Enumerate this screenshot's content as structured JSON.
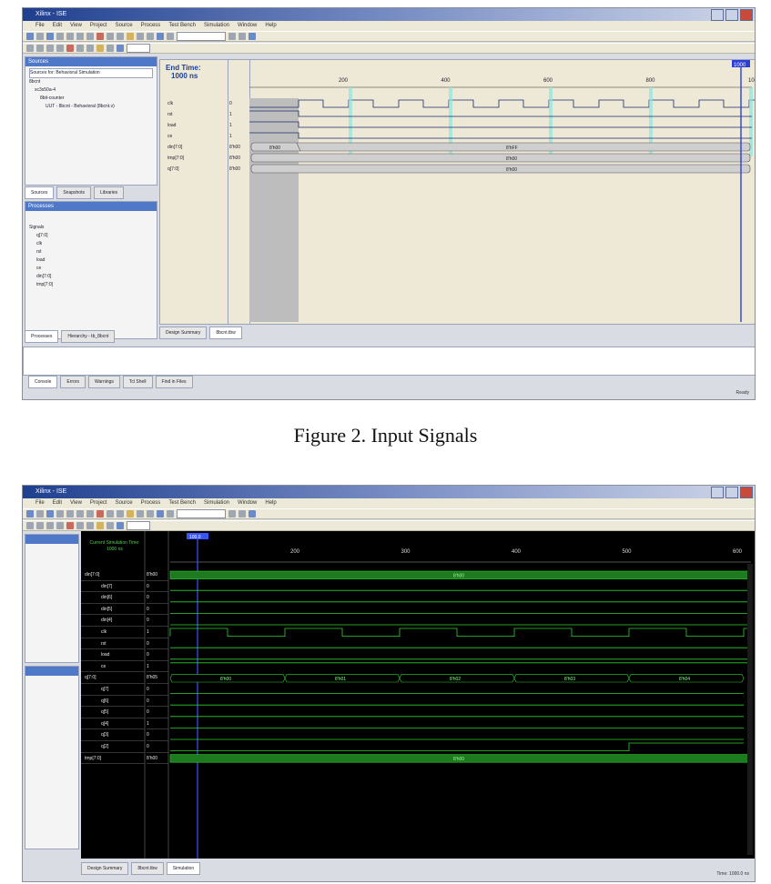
{
  "figure1": {
    "caption": "Figure 2.    Input Signals",
    "menu": [
      "File",
      "Edit",
      "View",
      "Project",
      "Source",
      "Process",
      "Test Bench",
      "Simulation",
      "Window",
      "Help"
    ],
    "sources_panel": {
      "title": "Sources",
      "subtitle": "Sources for: Behavioral Simulation",
      "tree": [
        "8bcnt",
        "xc3s50a-4",
        "8bit-counter",
        "UUT - 8bcnt - Behavioral (8bcnt.v)"
      ]
    },
    "left_tabs": [
      "Sources",
      "Snapshots",
      "Libraries"
    ],
    "process_panel": {
      "title": "Processes",
      "tree": [
        "Signals",
        "q[7:0]",
        "clk",
        "rst",
        "load",
        "ce",
        "din[7:0]",
        "tmp[7:0]"
      ]
    },
    "bottom_tabs": [
      "Processes",
      "Hierarchy - tb_8bcnt"
    ],
    "editor_tabs": [
      "Design Summary",
      "8bcnt.tbw"
    ],
    "end_time_label": "End Time:",
    "end_time_value": "1000 ns",
    "signals": [
      {
        "name": "clk",
        "value": "0"
      },
      {
        "name": "rst",
        "value": "1"
      },
      {
        "name": "load",
        "value": "1"
      },
      {
        "name": "ce",
        "value": "1"
      },
      {
        "name": "din[7:0]",
        "value": "8'h00"
      },
      {
        "name": "tmp[7:0]",
        "value": "8'h00"
      },
      {
        "name": "q[7:0]",
        "value": "8'h00"
      }
    ],
    "ruler_ticks": [
      "200",
      "400",
      "600",
      "800",
      "1000"
    ],
    "cursor_label": "1000",
    "bus_labels": [
      "8'h00",
      "8'hFF",
      "8'h00",
      "8'h00"
    ],
    "output_tabs": [
      "Console",
      "Errors",
      "Warnings",
      "Tcl Shell",
      "Find in Files"
    ],
    "status": "Ready"
  },
  "figure2": {
    "menu": [
      "File",
      "Edit",
      "View",
      "Project",
      "Source",
      "Process",
      "Test Bench",
      "Simulation",
      "Window",
      "Help"
    ],
    "cursor_label": "100.0",
    "time_header": "Current Simulation Time: 1000 ns",
    "ruler_ticks": [
      "200",
      "300",
      "400",
      "500",
      "600"
    ],
    "signals": [
      {
        "name": "din[7:0]",
        "value": "8'h00",
        "kind": "bus"
      },
      {
        "name": "din[7]",
        "value": "0",
        "kind": "bit"
      },
      {
        "name": "din[6]",
        "value": "0",
        "kind": "bit"
      },
      {
        "name": "din[5]",
        "value": "0",
        "kind": "bit"
      },
      {
        "name": "din[4]",
        "value": "0",
        "kind": "bit"
      },
      {
        "name": "clk",
        "value": "1",
        "kind": "bit"
      },
      {
        "name": "rst",
        "value": "0",
        "kind": "bit"
      },
      {
        "name": "load",
        "value": "0",
        "kind": "bit"
      },
      {
        "name": "ce",
        "value": "1",
        "kind": "bit"
      },
      {
        "name": "q[7:0]",
        "value": "8'h05",
        "kind": "bus"
      },
      {
        "name": "q[7]",
        "value": "0",
        "kind": "bit"
      },
      {
        "name": "q[6]",
        "value": "0",
        "kind": "bit"
      },
      {
        "name": "q[5]",
        "value": "0",
        "kind": "bit"
      },
      {
        "name": "q[4]",
        "value": "1",
        "kind": "bit"
      },
      {
        "name": "q[3]",
        "value": "0",
        "kind": "bit"
      },
      {
        "name": "q[2]",
        "value": "0",
        "kind": "bit"
      },
      {
        "name": "tmp[7:0]",
        "value": "8'h00",
        "kind": "bus"
      }
    ],
    "bus_segments": {
      "din": [
        "8'h00"
      ],
      "q": [
        "8'h00",
        "8'h01",
        "8'h02",
        "8'h03",
        "8'h04"
      ],
      "tmp": [
        "8'h00"
      ]
    },
    "bottom_tabs": [
      "Design Summary",
      "8bcnt.tbw",
      "Simulation"
    ],
    "status": "Time: 1000.0 ns"
  }
}
